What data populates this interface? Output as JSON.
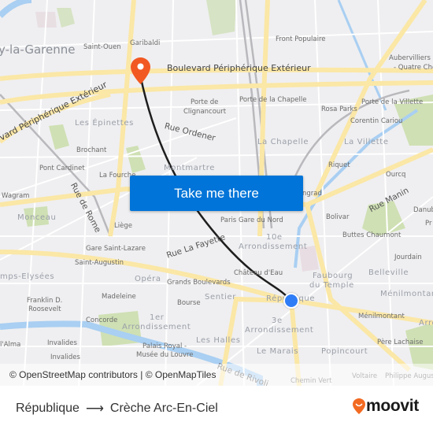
{
  "map": {
    "labels": {
      "levallois": "y-la-Garenne",
      "saint_ouen": "Saint-Ouen",
      "garibaldi": "Garibaldi",
      "front_populaire": "Front Populaire",
      "aubervilliers_1": "Aubervilliers -",
      "aubervilliers_2": "- Quatre Che",
      "bd_peripherique_ext_1": "Boulevard Périphérique Extérieur",
      "bd_peripherique_ext_2": "vard Périphérique Extérieur",
      "porte_clignancourt_1": "Porte de",
      "porte_clignancourt_2": "Clignancourt",
      "porte_chapelle": "Porte de la Chapelle",
      "rosa_parks": "Rosa Parks",
      "porte_villette": "Porte de la Villette",
      "corentin_cariou": "Corentin Cariou",
      "les_epinettes": "Les Épinettes",
      "rue_ordener": "Rue Ordener",
      "la_chapelle": "La Chapelle",
      "la_villette": "La Villette",
      "brochant": "Brochant",
      "pont_cardinet": "Pont Cardinet",
      "la_fourche": "La Fourche",
      "montmartre": "Montmartre",
      "riquet": "Riquet",
      "ourcq": "Ourcq",
      "wagram": "Wagram",
      "rue_de_rome": "Rue de Rome",
      "stalingrad": "ngrad",
      "rue_manin": "Rue Manin",
      "danube": "Danub",
      "monceau": "Monceau",
      "liege": "Liège",
      "gare_du_nord": "Paris Gare du Nord",
      "bolivar": "Bolivar",
      "pre": "Pr",
      "buttes_chaumont": "Buttes Chaumont",
      "gare_saint_lazare": "Gare Saint-Lazare",
      "rue_la_fayette": "Rue La Fayette",
      "arr10_1": "10e",
      "arr10_2": "Arrondissement",
      "jourdain": "Jourdain",
      "saint_augustin": "Saint-Augustin",
      "champs_elysees": "mps-Elysées",
      "opera": "Opéra",
      "grands_boulevards": "Grands Boulevards",
      "chateau_deau": "Château d'Eau",
      "faubourg_1": "Faubourg",
      "faubourg_2": "du Temple",
      "belleville": "Belleville",
      "madeleine": "Madeleine",
      "sentier": "Sentier",
      "republique": "République",
      "menilmontant_dist": "Ménilmontan",
      "franklin_1": "Franklin D.",
      "franklin_2": "Roosevelt",
      "bourse": "Bourse",
      "menilmontant_st": "Ménilmontant",
      "arr": "Arro",
      "concorde": "Concorde",
      "arr1_1": "1er",
      "arr1_2": "Arrondissement",
      "arr3_1": "3e",
      "arr3_2": "Arrondissement",
      "alma": "l'Alma",
      "invalides_1": "Invalides",
      "invalides_2": "Invalides",
      "palais_royal_1": "Palais Royal -",
      "palais_royal_2": "Musée du Louvre",
      "les_halles": "Les Halles",
      "le_marais": "Le Marais",
      "popincourt": "Popincourt",
      "pere_lachaise": "Père Lachaise",
      "rue_de_rivoli": "Rue de Rivoli",
      "chemin_vert": "Chemin Vert",
      "voltaire": "Voltaire",
      "philippe_auguste": "Philippe August"
    },
    "destination_pin": "destination-pin-icon",
    "origin_marker": "current-location-marker",
    "colors": {
      "route": "#1e1e1e",
      "pin": "#f25822",
      "origin": "#2f7df6",
      "water": "#a9cff2",
      "park": "#cfe0b4",
      "major_road": "#fbe7a6"
    }
  },
  "cta": {
    "label": "Take me there",
    "color": "#0074d8"
  },
  "attribution": "© OpenStreetMap contributors | © OpenMapTiles",
  "footer": {
    "origin": "République",
    "arrow": "⟶",
    "destination": "Crèche Arc-En-Ciel",
    "brand": "moovit",
    "brand_color": "#f26a21"
  }
}
